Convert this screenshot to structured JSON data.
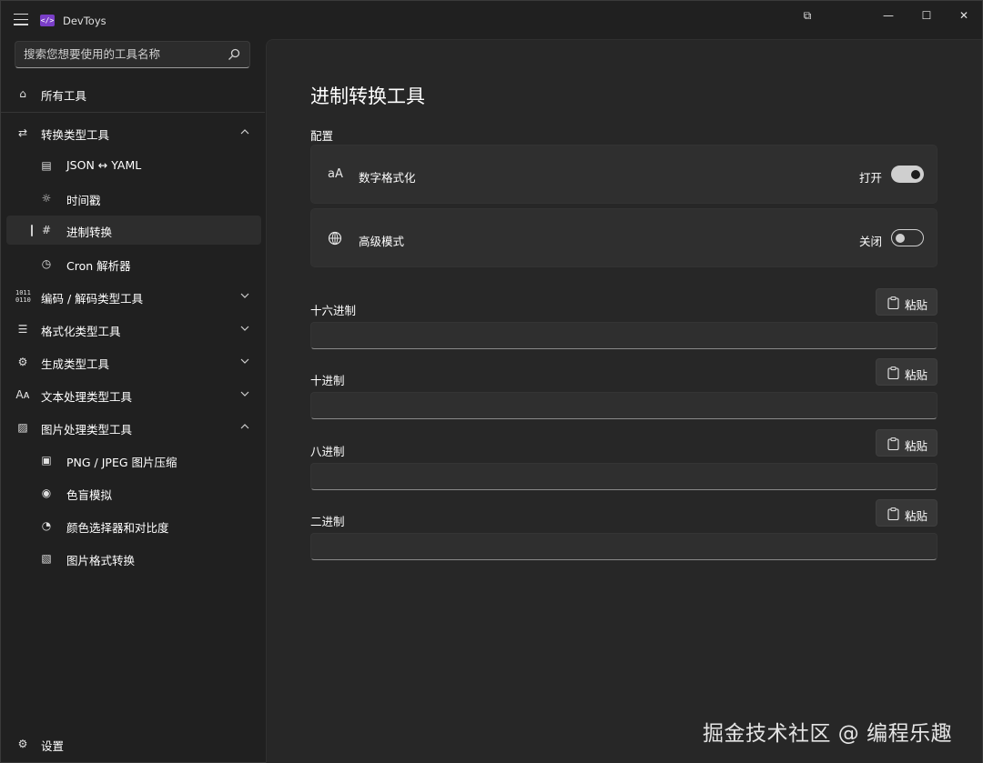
{
  "app": {
    "title": "DevToys",
    "logo_text": "</>"
  },
  "window_controls": {
    "compact_overlay": "⧉",
    "minimize": "—",
    "maximize": "☐",
    "close": "✕"
  },
  "search": {
    "placeholder": "搜索您想要使用的工具名称"
  },
  "sidebar": {
    "all_tools": {
      "label": "所有工具",
      "icon": "home-icon"
    },
    "groups": [
      {
        "label": "转换类型工具",
        "icon": "converter-icon",
        "expanded": true,
        "items": [
          {
            "label": "JSON ↔ YAML",
            "icon": "json-yaml-icon"
          },
          {
            "label": "时间戳",
            "icon": "timestamp-icon"
          },
          {
            "label": "进制转换",
            "icon": "number-base-icon",
            "active": true
          },
          {
            "label": "Cron 解析器",
            "icon": "clock-icon"
          }
        ]
      },
      {
        "label": "编码 / 解码类型工具",
        "icon": "binary-icon",
        "expanded": false
      },
      {
        "label": "格式化类型工具",
        "icon": "format-icon",
        "expanded": false
      },
      {
        "label": "生成类型工具",
        "icon": "generator-icon",
        "expanded": false
      },
      {
        "label": "文本处理类型工具",
        "icon": "text-icon",
        "expanded": false
      },
      {
        "label": "图片处理类型工具",
        "icon": "image-icon",
        "expanded": true,
        "items": [
          {
            "label": "PNG / JPEG 图片压缩",
            "icon": "image-compress-icon"
          },
          {
            "label": "色盲模拟",
            "icon": "eye-icon"
          },
          {
            "label": "颜色选择器和对比度",
            "icon": "palette-icon"
          },
          {
            "label": "图片格式转换",
            "icon": "image-convert-icon"
          }
        ]
      }
    ],
    "settings": {
      "label": "设置",
      "icon": "gear-icon"
    }
  },
  "main": {
    "title": "进制转换工具",
    "config_label": "配置",
    "settings": [
      {
        "label": "数字格式化",
        "icon_text": "aA",
        "state_label": "打开",
        "on": true
      },
      {
        "label": "高级模式",
        "icon_text": "",
        "state_label": "关闭",
        "on": false
      }
    ],
    "fields": [
      {
        "label": "十六进制",
        "value": "",
        "paste_label": "粘贴"
      },
      {
        "label": "十进制",
        "value": "",
        "paste_label": "粘贴"
      },
      {
        "label": "八进制",
        "value": "",
        "paste_label": "粘贴"
      },
      {
        "label": "二进制",
        "value": "",
        "paste_label": "粘贴"
      }
    ]
  },
  "watermark": "掘金技术社区 @ 编程乐趣",
  "colors": {
    "background": "#202020",
    "content": "#272727",
    "card": "#2f2f2f",
    "accent": "#7a3ec8"
  }
}
